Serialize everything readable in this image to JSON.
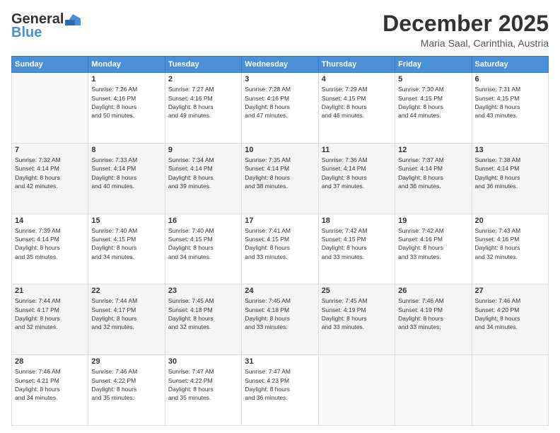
{
  "header": {
    "logo_line1": "General",
    "logo_line2": "Blue",
    "month_title": "December 2025",
    "location": "Maria Saal, Carinthia, Austria"
  },
  "days_of_week": [
    "Sunday",
    "Monday",
    "Tuesday",
    "Wednesday",
    "Thursday",
    "Friday",
    "Saturday"
  ],
  "weeks": [
    [
      {
        "day": "",
        "info": ""
      },
      {
        "day": "1",
        "info": "Sunrise: 7:26 AM\nSunset: 4:16 PM\nDaylight: 8 hours\nand 50 minutes."
      },
      {
        "day": "2",
        "info": "Sunrise: 7:27 AM\nSunset: 4:16 PM\nDaylight: 8 hours\nand 49 minutes."
      },
      {
        "day": "3",
        "info": "Sunrise: 7:28 AM\nSunset: 4:16 PM\nDaylight: 8 hours\nand 47 minutes."
      },
      {
        "day": "4",
        "info": "Sunrise: 7:29 AM\nSunset: 4:15 PM\nDaylight: 8 hours\nand 46 minutes."
      },
      {
        "day": "5",
        "info": "Sunrise: 7:30 AM\nSunset: 4:15 PM\nDaylight: 8 hours\nand 44 minutes."
      },
      {
        "day": "6",
        "info": "Sunrise: 7:31 AM\nSunset: 4:15 PM\nDaylight: 8 hours\nand 43 minutes."
      }
    ],
    [
      {
        "day": "7",
        "info": "Sunrise: 7:32 AM\nSunset: 4:14 PM\nDaylight: 8 hours\nand 42 minutes."
      },
      {
        "day": "8",
        "info": "Sunrise: 7:33 AM\nSunset: 4:14 PM\nDaylight: 8 hours\nand 40 minutes."
      },
      {
        "day": "9",
        "info": "Sunrise: 7:34 AM\nSunset: 4:14 PM\nDaylight: 8 hours\nand 39 minutes."
      },
      {
        "day": "10",
        "info": "Sunrise: 7:35 AM\nSunset: 4:14 PM\nDaylight: 8 hours\nand 38 minutes."
      },
      {
        "day": "11",
        "info": "Sunrise: 7:36 AM\nSunset: 4:14 PM\nDaylight: 8 hours\nand 37 minutes."
      },
      {
        "day": "12",
        "info": "Sunrise: 7:37 AM\nSunset: 4:14 PM\nDaylight: 8 hours\nand 36 minutes."
      },
      {
        "day": "13",
        "info": "Sunrise: 7:38 AM\nSunset: 4:14 PM\nDaylight: 8 hours\nand 36 minutes."
      }
    ],
    [
      {
        "day": "14",
        "info": "Sunrise: 7:39 AM\nSunset: 4:14 PM\nDaylight: 8 hours\nand 35 minutes."
      },
      {
        "day": "15",
        "info": "Sunrise: 7:40 AM\nSunset: 4:15 PM\nDaylight: 8 hours\nand 34 minutes."
      },
      {
        "day": "16",
        "info": "Sunrise: 7:40 AM\nSunset: 4:15 PM\nDaylight: 8 hours\nand 34 minutes."
      },
      {
        "day": "17",
        "info": "Sunrise: 7:41 AM\nSunset: 4:15 PM\nDaylight: 8 hours\nand 33 minutes."
      },
      {
        "day": "18",
        "info": "Sunrise: 7:42 AM\nSunset: 4:15 PM\nDaylight: 8 hours\nand 33 minutes."
      },
      {
        "day": "19",
        "info": "Sunrise: 7:42 AM\nSunset: 4:16 PM\nDaylight: 8 hours\nand 33 minutes."
      },
      {
        "day": "20",
        "info": "Sunrise: 7:43 AM\nSunset: 4:16 PM\nDaylight: 8 hours\nand 32 minutes."
      }
    ],
    [
      {
        "day": "21",
        "info": "Sunrise: 7:44 AM\nSunset: 4:17 PM\nDaylight: 8 hours\nand 32 minutes."
      },
      {
        "day": "22",
        "info": "Sunrise: 7:44 AM\nSunset: 4:17 PM\nDaylight: 8 hours\nand 32 minutes."
      },
      {
        "day": "23",
        "info": "Sunrise: 7:45 AM\nSunset: 4:18 PM\nDaylight: 8 hours\nand 32 minutes."
      },
      {
        "day": "24",
        "info": "Sunrise: 7:45 AM\nSunset: 4:18 PM\nDaylight: 8 hours\nand 33 minutes."
      },
      {
        "day": "25",
        "info": "Sunrise: 7:45 AM\nSunset: 4:19 PM\nDaylight: 8 hours\nand 33 minutes."
      },
      {
        "day": "26",
        "info": "Sunrise: 7:46 AM\nSunset: 4:19 PM\nDaylight: 8 hours\nand 33 minutes."
      },
      {
        "day": "27",
        "info": "Sunrise: 7:46 AM\nSunset: 4:20 PM\nDaylight: 8 hours\nand 34 minutes."
      }
    ],
    [
      {
        "day": "28",
        "info": "Sunrise: 7:46 AM\nSunset: 4:21 PM\nDaylight: 8 hours\nand 34 minutes."
      },
      {
        "day": "29",
        "info": "Sunrise: 7:46 AM\nSunset: 4:22 PM\nDaylight: 8 hours\nand 35 minutes."
      },
      {
        "day": "30",
        "info": "Sunrise: 7:47 AM\nSunset: 4:22 PM\nDaylight: 8 hours\nand 35 minutes."
      },
      {
        "day": "31",
        "info": "Sunrise: 7:47 AM\nSunset: 4:23 PM\nDaylight: 8 hours\nand 36 minutes."
      },
      {
        "day": "",
        "info": ""
      },
      {
        "day": "",
        "info": ""
      },
      {
        "day": "",
        "info": ""
      }
    ]
  ]
}
